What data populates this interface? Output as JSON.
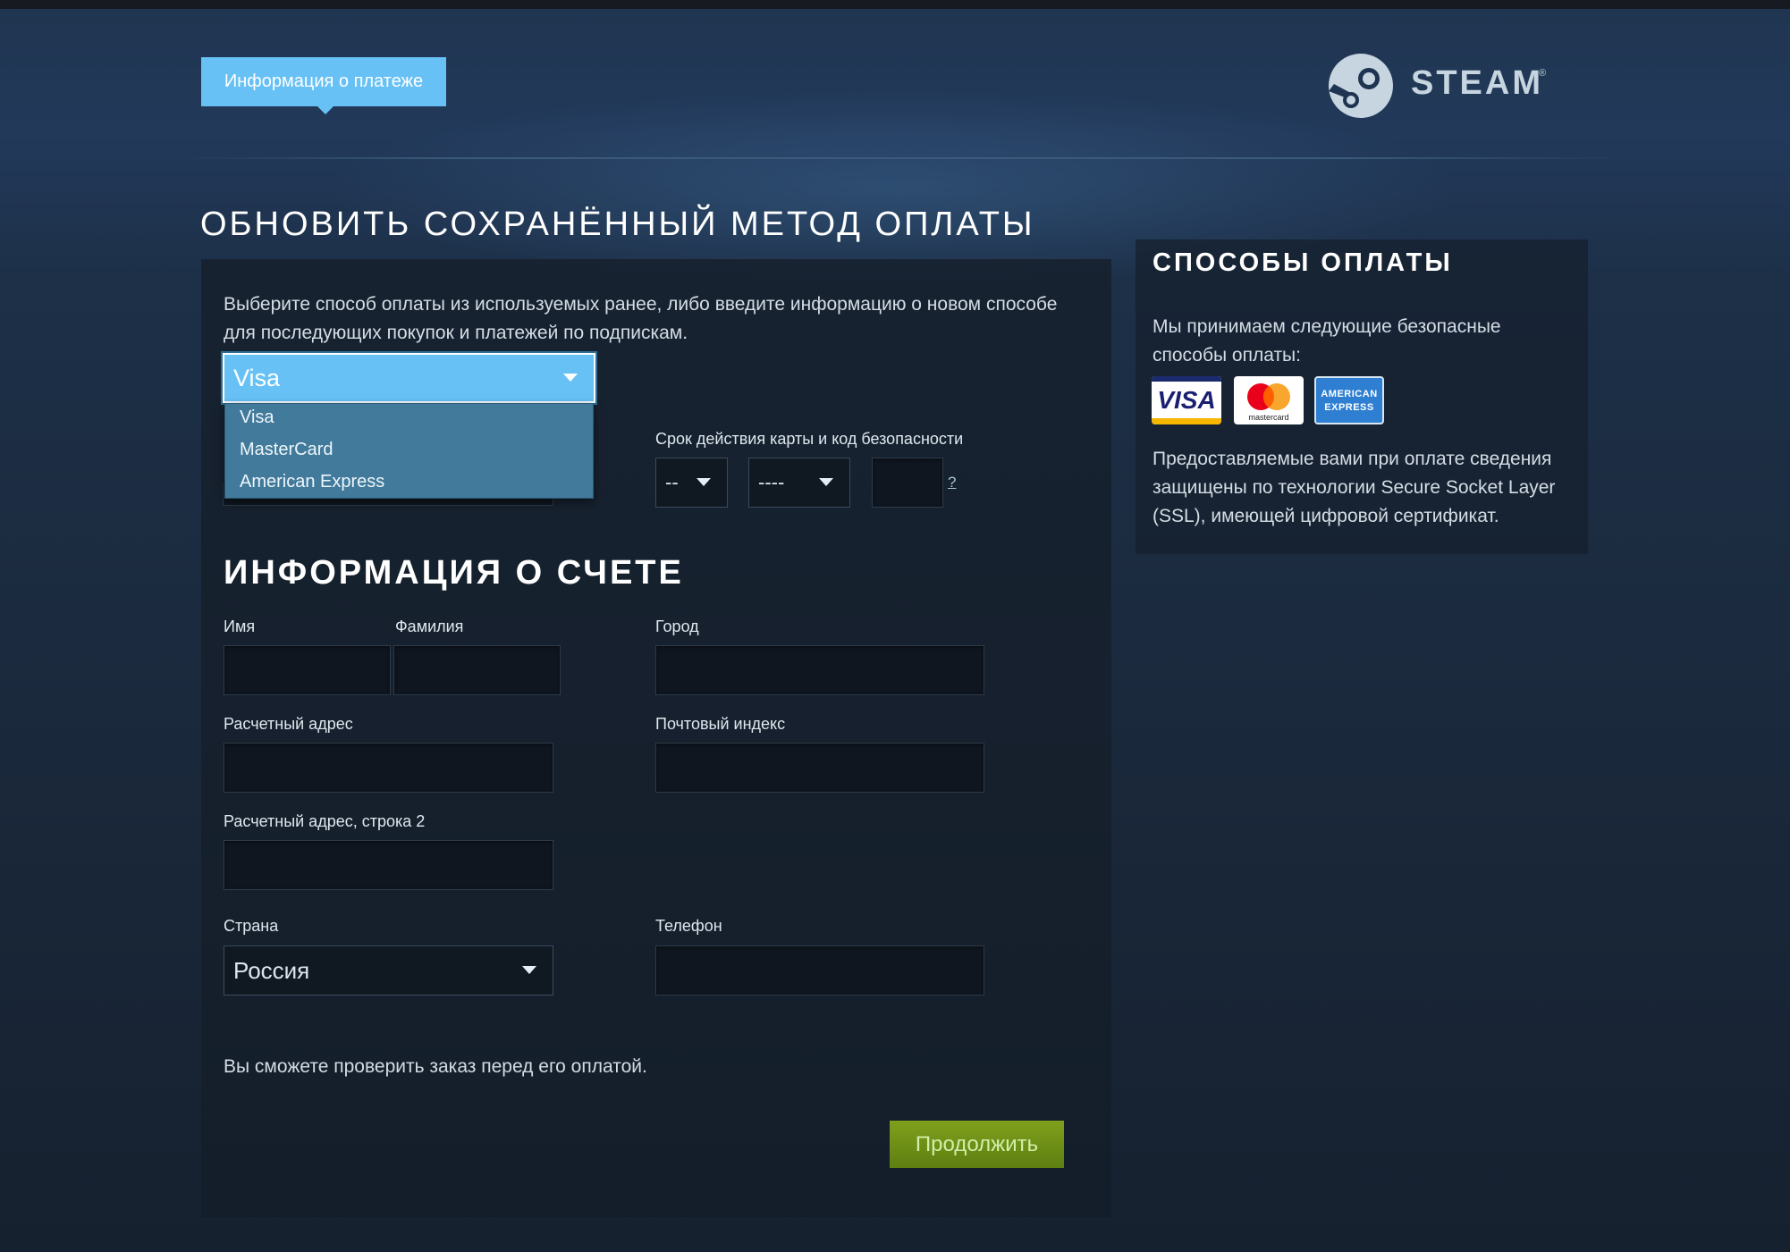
{
  "header": {
    "tab_label": "Информация о платеже",
    "logo_text": "STEAM",
    "logo_reg": "®"
  },
  "page_title": "ОБНОВИТЬ СОХРАНЁННЫЙ МЕТОД ОПЛАТЫ",
  "intro_text": "Выберите способ оплаты из используемых ранее, либо введите информацию о новом способе для последующих покупок и платежей по подпискам.",
  "payment_method": {
    "selected": "Visa",
    "options": [
      "Visa",
      "MasterCard",
      "American Express"
    ]
  },
  "card_expiry": {
    "label": "Срок действия карты и код безопасности",
    "month_value": "--",
    "year_value": "----",
    "cvv_value": "",
    "help_text": "?"
  },
  "account_section": {
    "title": "ИНФОРМАЦИЯ О СЧЕТЕ",
    "first_name_label": "Имя",
    "last_name_label": "Фамилия",
    "city_label": "Город",
    "billing_address_label": "Расчетный адрес",
    "postal_code_label": "Почтовый индекс",
    "billing_address2_label": "Расчетный адрес, строка 2",
    "country_label": "Страна",
    "country_value": "Россия",
    "phone_label": "Телефон"
  },
  "review_note": "Вы сможете проверить заказ перед его оплатой.",
  "continue_label": "Продолжить",
  "side": {
    "title": "СПОСОБЫ ОПЛАТЫ",
    "accept_text": "Мы принимаем следующие безопасные способы оплаты:",
    "cards": {
      "visa_text": "VISA",
      "mastercard_text": "mastercard",
      "amex_line1": "AMERICAN",
      "amex_line2": "EXPRESS"
    },
    "ssl_text": "Предоставляемые вами при оплате сведения защищены по технологии Secure Socket Layer (SSL), имеющей цифровой сертификат."
  },
  "colors": {
    "accent": "#67c1f5",
    "button_green": "#6d8f16",
    "background": "#1b2838"
  }
}
